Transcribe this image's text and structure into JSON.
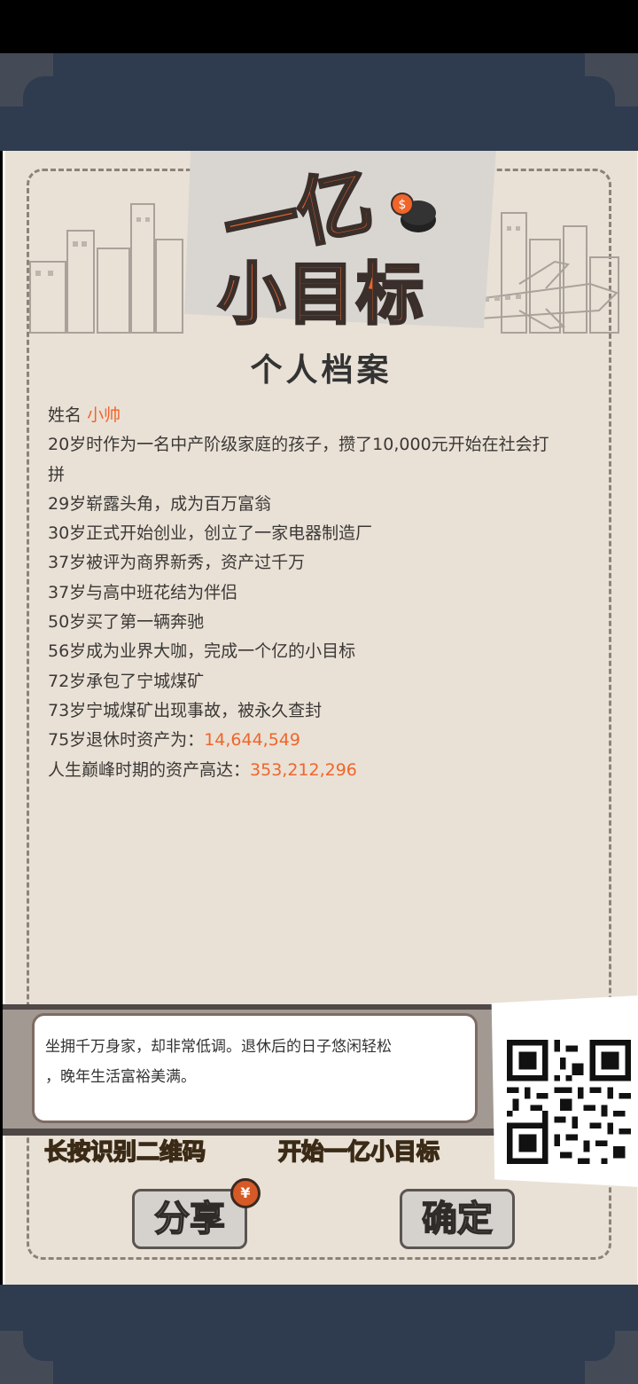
{
  "logo": {
    "line1": "一亿",
    "line2": "小目标"
  },
  "title": "个人档案",
  "profile": {
    "name_label": "姓名",
    "name_value": "小帅",
    "events": [
      "20岁时作为一名中产阶级家庭的孩子，攒了10,000元开始在社会打",
      "拼",
      "29岁崭露头角，成为百万富翁",
      "30岁正式开始创业，创立了一家电器制造厂",
      "37岁被评为商界新秀，资产过千万",
      "37岁与高中班花结为伴侣",
      "50岁买了第一辆奔驰",
      "56岁成为业界大咖，完成一个亿的小目标",
      "72岁承包了宁城煤矿",
      "73岁宁城煤矿出现事故，被永久查封"
    ],
    "retire_label": "75岁退休时资产为：",
    "retire_value": "14,644,549",
    "peak_label": "人生巅峰时期的资产高达：",
    "peak_value": "353,212,296"
  },
  "comment": {
    "line1": "坐拥千万身家，却非常低调。退休后的日子悠闲轻松",
    "line2": "，晚年生活富裕美满。"
  },
  "taglines": {
    "left": "长按识别二维码",
    "right": "开始一亿小目标"
  },
  "buttons": {
    "share": "分享",
    "confirm": "确定",
    "coin_symbol": "¥"
  },
  "colors": {
    "accent": "#f0652a",
    "paper": "#e9e1d6",
    "navy": "#2f3b4f",
    "tagline": "#f7b23b"
  }
}
